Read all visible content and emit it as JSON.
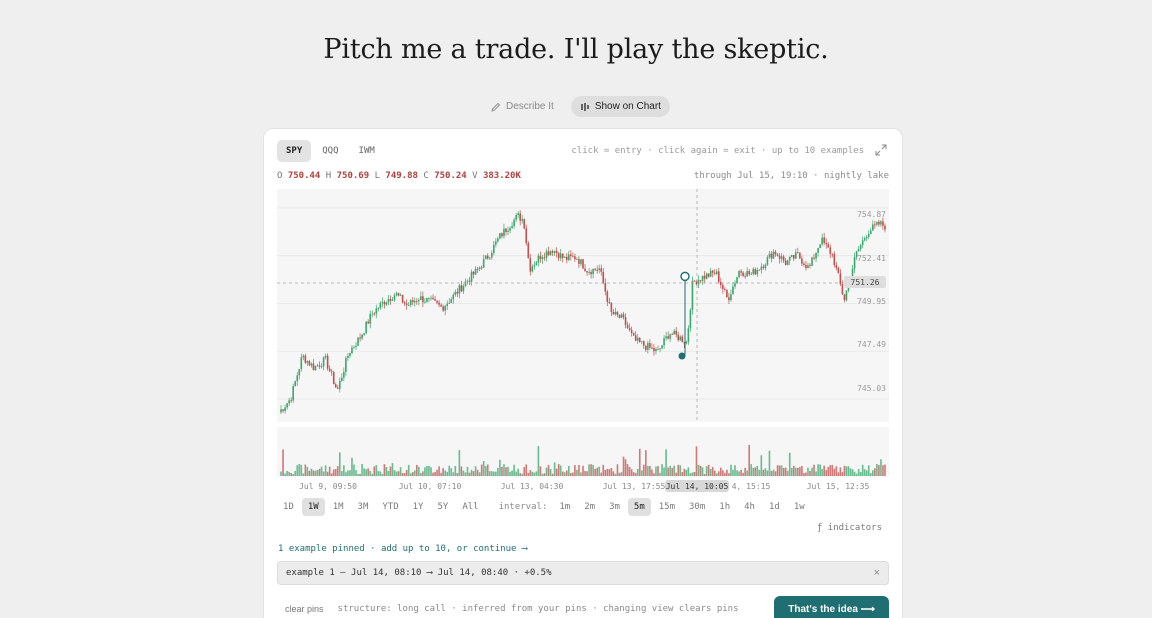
{
  "headline": "Pitch me a trade. I'll play the skeptic.",
  "mode_tabs": [
    {
      "label": "Describe It",
      "icon": "pencil-icon",
      "active": false
    },
    {
      "label": "Show on Chart",
      "icon": "chart-icon",
      "active": true
    }
  ],
  "tickers": [
    "SPY",
    "QQQ",
    "IWM"
  ],
  "active_ticker": "SPY",
  "hint": "click = entry · click again = exit · up to 10 examples",
  "ohlc": {
    "o_label": "O",
    "o": "750.44",
    "h_label": "H",
    "h": "750.69",
    "l_label": "L",
    "l": "749.88",
    "c_label": "C",
    "c": "750.24",
    "v_label": "V",
    "v": "383.20K"
  },
  "through": "through Jul 15, 19:10 · nightly lake",
  "colors": {
    "up": "#3aa76d",
    "down": "#c0504d",
    "accent": "#1e6e72",
    "value_text": "#b0413e"
  },
  "chart_data": {
    "type": "candlestick",
    "y_ticks": [
      "754.87",
      "752.41",
      "749.95",
      "747.49",
      "745.03"
    ],
    "current_price_label": "751.26",
    "x_ticks": [
      "Jul 9, 09:50",
      "Jul 10, 07:10",
      "Jul 13, 04:30",
      "Jul 13, 17:55",
      "Jul 14, 10:05",
      "4, 15:15",
      "Jul 15, 12:35"
    ],
    "crosshair_label": "Jul 14, 10:05",
    "ylim": [
      744.0,
      756.0
    ],
    "close_path": [
      [
        0,
        744.5
      ],
      [
        2,
        745.2
      ],
      [
        4,
        747.4
      ],
      [
        6,
        746.8
      ],
      [
        8,
        747.2
      ],
      [
        10,
        745.6
      ],
      [
        12,
        747.6
      ],
      [
        14,
        748.4
      ],
      [
        16,
        749.6
      ],
      [
        18,
        750.2
      ],
      [
        20,
        750.6
      ],
      [
        22,
        750.0
      ],
      [
        24,
        750.4
      ],
      [
        26,
        750.2
      ],
      [
        28,
        749.9
      ],
      [
        30,
        750.5
      ],
      [
        32,
        751.2
      ],
      [
        34,
        751.8
      ],
      [
        36,
        752.6
      ],
      [
        38,
        753.6
      ],
      [
        40,
        754.3
      ],
      [
        41,
        754.6
      ],
      [
        42,
        754.4
      ],
      [
        43,
        751.9
      ],
      [
        45,
        752.6
      ],
      [
        47,
        752.9
      ],
      [
        49,
        752.4
      ],
      [
        51,
        752.5
      ],
      [
        53,
        751.8
      ],
      [
        55,
        751.9
      ],
      [
        57,
        749.6
      ],
      [
        59,
        749.3
      ],
      [
        61,
        748.2
      ],
      [
        63,
        747.9
      ],
      [
        65,
        747.6
      ],
      [
        67,
        748.6
      ],
      [
        69,
        748.3
      ],
      [
        70,
        748.1
      ],
      [
        71,
        751.2
      ],
      [
        73,
        751.5
      ],
      [
        75,
        751.7
      ],
      [
        77,
        750.3
      ],
      [
        79,
        751.8
      ],
      [
        81,
        751.6
      ],
      [
        83,
        752.1
      ],
      [
        85,
        752.8
      ],
      [
        87,
        752.2
      ],
      [
        89,
        752.6
      ],
      [
        91,
        751.9
      ],
      [
        93,
        753.4
      ],
      [
        95,
        752.6
      ],
      [
        97,
        750.3
      ],
      [
        99,
        752.6
      ],
      [
        101,
        753.8
      ],
      [
        103,
        754.2
      ],
      [
        104,
        754.1
      ]
    ],
    "pins": [
      {
        "kind": "entry",
        "price": 751.5
      },
      {
        "kind": "exit",
        "price": 747.4
      }
    ]
  },
  "ranges": [
    "1D",
    "1W",
    "1M",
    "3M",
    "YTD",
    "1Y",
    "5Y",
    "All"
  ],
  "active_range": "1W",
  "interval_label": "interval:",
  "intervals": [
    "1m",
    "2m",
    "3m",
    "5m",
    "15m",
    "30m",
    "1h",
    "4h",
    "1d",
    "1w"
  ],
  "active_interval": "5m",
  "indicators": "ƒ indicators",
  "pinned_text": "1 example pinned · add up to 10, or continue ⟶",
  "example_text": "example 1 — Jul 14, 08:10 ⟶ Jul 14, 08:40 · +0.5%",
  "clear_pins": "clear pins",
  "structure_text": "structure: long call · inferred from your pins · changing view clears pins",
  "cta": "That's the idea ⟶"
}
